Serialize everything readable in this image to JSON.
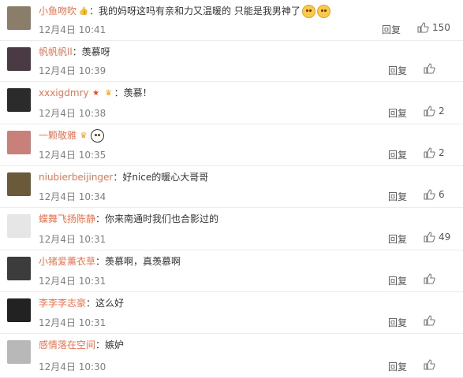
{
  "reply_label": "回复",
  "comments": [
    {
      "user": "小鱼吻吹",
      "text": "：我的妈呀这吗有亲和力又温暖的 只能是我男神了",
      "time": "12月4日 10:41",
      "likes": "150",
      "badge": "thumb",
      "emojis": 2,
      "avatar_color": "#8a7d6a"
    },
    {
      "user": "帆帆帆ll",
      "text": "：羡慕呀",
      "time": "12月4日 10:39",
      "likes": "",
      "badge": "",
      "emojis": 0,
      "avatar_color": "#4a3a44"
    },
    {
      "user": "xxxigdmry",
      "text": "：羡慕！",
      "time": "12月4日 10:38",
      "likes": "2",
      "badge": "star-crown",
      "emojis": 0,
      "avatar_color": "#2b2b2b"
    },
    {
      "user": "一颗敬雅",
      "text": "",
      "time": "12月4日 10:35",
      "likes": "2",
      "badge": "crown",
      "emojis": 1,
      "avatar_color": "#c9807a"
    },
    {
      "user": "niubierbeijinger",
      "text": "：好nice的暖心大哥哥",
      "time": "12月4日 10:34",
      "likes": "6",
      "badge": "",
      "emojis": 0,
      "avatar_color": "#6a5a3a"
    },
    {
      "user": "蝶舞飞扬陈静",
      "text": "：你来南通时我们也合影过的",
      "time": "12月4日 10:31",
      "likes": "49",
      "badge": "",
      "emojis": 0,
      "avatar_color": "#e6e6e6"
    },
    {
      "user": "小猪爱薰衣草",
      "text": "：羡慕啊，真羡慕啊",
      "time": "12月4日 10:31",
      "likes": "",
      "badge": "",
      "emojis": 0,
      "avatar_color": "#3c3c3c"
    },
    {
      "user": "李李李志豪",
      "text": "：这么好",
      "time": "12月4日 10:31",
      "likes": "",
      "badge": "",
      "emojis": 0,
      "avatar_color": "#222222"
    },
    {
      "user": "感情落在空间",
      "text": "：嫉妒",
      "time": "12月4日 10:30",
      "likes": "",
      "badge": "",
      "emojis": 0,
      "avatar_color": "#b8b8b8"
    }
  ]
}
